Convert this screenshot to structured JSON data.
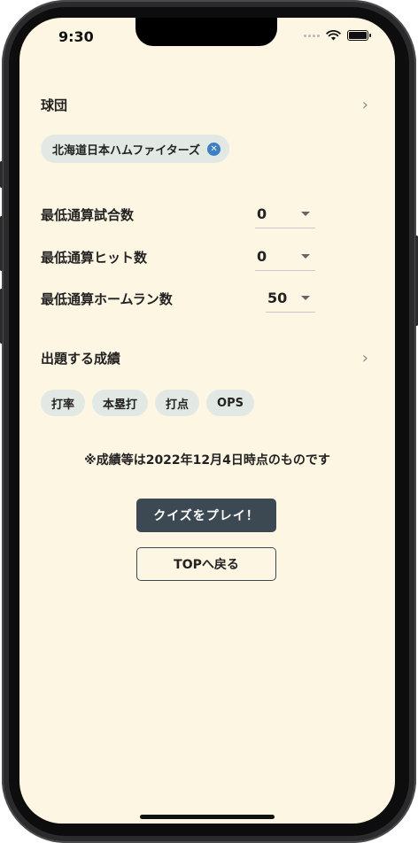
{
  "status": {
    "time": "9:30"
  },
  "team_section": {
    "label": "球団",
    "selected_team": "北海道日本ハムファイターズ"
  },
  "filters": [
    {
      "label": "最低通算試合数",
      "value": "0"
    },
    {
      "label": "最低通算ヒット数",
      "value": "0"
    },
    {
      "label": "最低通算ホームラン数",
      "value": "50"
    }
  ],
  "stats_section": {
    "label": "出題する成績",
    "stats": [
      "打率",
      "本塁打",
      "打点",
      "OPS"
    ]
  },
  "note": "※成績等は2022年12月4日時点のものです",
  "buttons": {
    "play": "クイズをプレイ！",
    "back": "TOPへ戻る"
  },
  "icons": {
    "chevron": "chevron-right-icon",
    "remove": "remove-chip-icon",
    "caret": "caret-down-icon"
  },
  "colors": {
    "background": "#fdf6e3",
    "chip": "#e2e9e4",
    "primary_button": "#3c4953",
    "remove_icon": "#3b7fc4"
  }
}
